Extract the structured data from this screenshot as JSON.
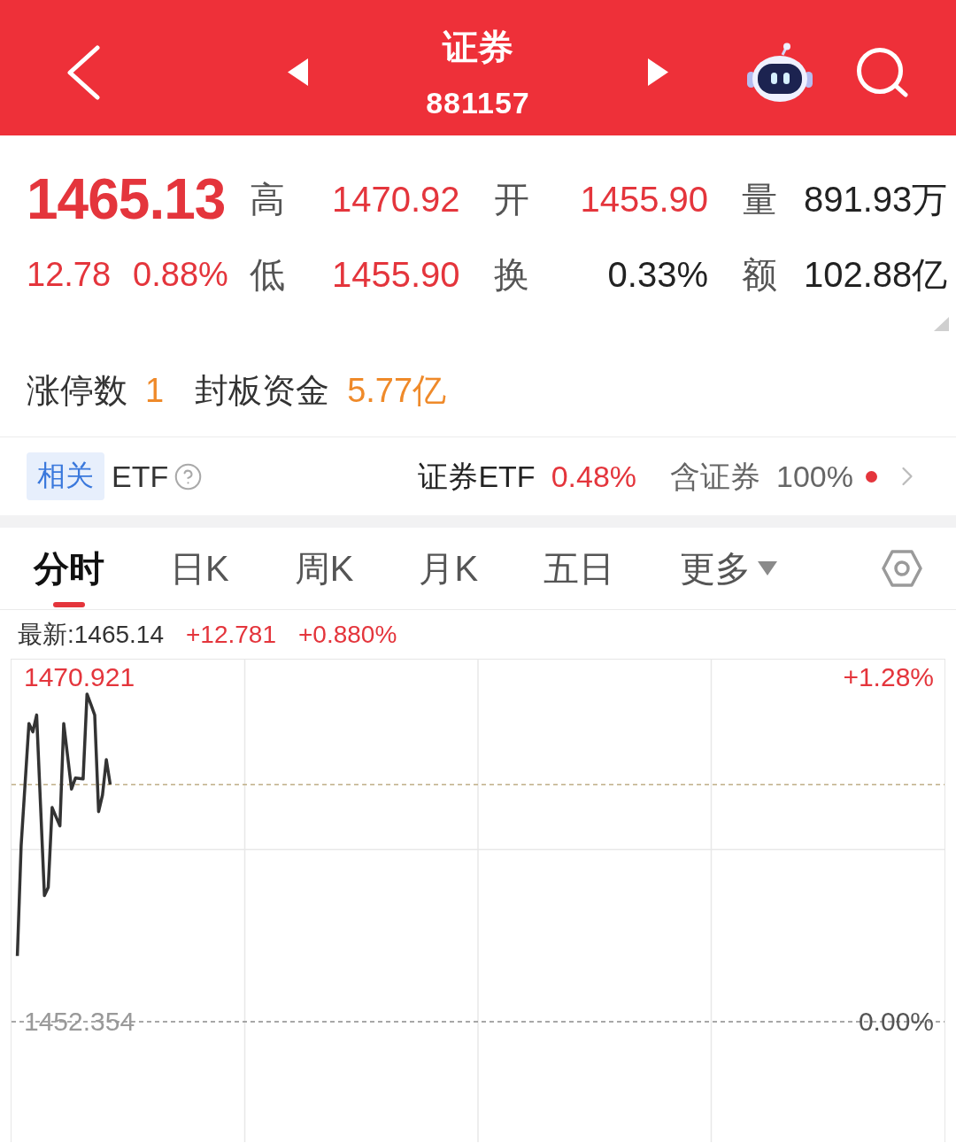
{
  "header": {
    "title": "证券",
    "code": "881157"
  },
  "quote": {
    "price": "1465.13",
    "change": "12.78",
    "change_pct": "0.88%",
    "stats": [
      {
        "label": "高",
        "value": "1470.92",
        "kind": "price"
      },
      {
        "label": "开",
        "value": "1455.90",
        "kind": "price"
      },
      {
        "label": "量",
        "value": "891.93万",
        "kind": "plain"
      },
      {
        "label": "低",
        "value": "1455.90",
        "kind": "price"
      },
      {
        "label": "换",
        "value": "0.33%",
        "kind": "plain"
      },
      {
        "label": "额",
        "value": "102.88亿",
        "kind": "plain"
      }
    ]
  },
  "limit_up": [
    {
      "label": "涨停数",
      "value": "1"
    },
    {
      "label": "封板资金",
      "value": "5.77亿"
    }
  ],
  "etf": {
    "tag": "相关",
    "label": "ETF",
    "fund_name": "证券ETF",
    "fund_change": "0.48%",
    "holding_label": "含证券",
    "holding_pct": "100%",
    "alert": true
  },
  "tabs": [
    {
      "label": "分时",
      "selected": true,
      "kind": "period"
    },
    {
      "label": "日K",
      "selected": false,
      "kind": "period"
    },
    {
      "label": "周K",
      "selected": false,
      "kind": "period"
    },
    {
      "label": "月K",
      "selected": false,
      "kind": "period"
    },
    {
      "label": "五日",
      "selected": false,
      "kind": "period"
    },
    {
      "label": "更多",
      "selected": false,
      "kind": "menu"
    }
  ],
  "intraday": {
    "latest": "最新:1465.14",
    "change": "+12.781",
    "change_pct": "+0.880%",
    "chart_data": {
      "type": "line",
      "categories": [
        null,
        null,
        null,
        null,
        null,
        null,
        null,
        null,
        null,
        null,
        null,
        null,
        null,
        null,
        null,
        null,
        null,
        null,
        null,
        null,
        null,
        null,
        null,
        null,
        null,
        null,
        null,
        null,
        null,
        null,
        null,
        null,
        null,
        null,
        null,
        null,
        null,
        null,
        null,
        null,
        null,
        null,
        null,
        null,
        null,
        null,
        null,
        null,
        null,
        null,
        null,
        null,
        null,
        null,
        null,
        null,
        null,
        null,
        null,
        null,
        null,
        null,
        null,
        null,
        null,
        null,
        null,
        null,
        null,
        null,
        null,
        null,
        null,
        null,
        null,
        null,
        null,
        null,
        null,
        null,
        null,
        null,
        null,
        null,
        null,
        null,
        null,
        null,
        null,
        null,
        null,
        null,
        null,
        null,
        null,
        null,
        null,
        null,
        null,
        null,
        null,
        null,
        null,
        null,
        null,
        null,
        null,
        null,
        null,
        null,
        null,
        null,
        null,
        null,
        null,
        null,
        null,
        null,
        null,
        null,
        null,
        null,
        null,
        null,
        null,
        null,
        null,
        null,
        null,
        null,
        null,
        null,
        null,
        null,
        null,
        null,
        null,
        null,
        null,
        null,
        null,
        null,
        null,
        null,
        null,
        null,
        null,
        null,
        null,
        null,
        null,
        null,
        null,
        null,
        null,
        null,
        null,
        null,
        null,
        null,
        null,
        null,
        null,
        null,
        null,
        null,
        null,
        null,
        null,
        null,
        null,
        null,
        null,
        null,
        null,
        null,
        null,
        null,
        null,
        null,
        null,
        null,
        null,
        null,
        null,
        null,
        null,
        null,
        null,
        null,
        null,
        null,
        null,
        null,
        null,
        null,
        null,
        null,
        null,
        null,
        null,
        null,
        null,
        null,
        null,
        null,
        null,
        null,
        null,
        null,
        null,
        null,
        null,
        null,
        null,
        null,
        null,
        null,
        null,
        null,
        null,
        null,
        null,
        null,
        null,
        null,
        null,
        null,
        null,
        null,
        null,
        null,
        null,
        null,
        null,
        null,
        null,
        null,
        null,
        null,
        null
      ],
      "series": [
        {
          "color": "#333333",
          "values": [
            null,
            1455.9,
            1461.86,
            1465.15,
            1468.43,
            1467.98,
            1468.89,
            1464.02,
            1459.15,
            1459.6,
            1463.9,
            1463.4,
            1462.91,
            1468.43,
            1466.67,
            1464.9,
            1465.49,
            1465.47,
            1465.44,
            1470.02,
            1469.46,
            1468.89,
            1463.68,
            1464.58,
            1466.48,
            1465.14,
            null,
            null,
            null,
            null,
            null,
            null,
            null,
            null,
            null,
            null,
            null,
            null,
            null,
            null,
            null,
            null,
            null,
            null,
            null,
            null,
            null,
            null,
            null,
            null,
            null,
            null,
            null,
            null,
            null,
            null,
            null,
            null,
            null,
            null,
            null,
            null,
            null,
            null,
            null,
            null,
            null,
            null,
            null,
            null,
            null,
            null,
            null,
            null,
            null,
            null,
            null,
            null,
            null,
            null,
            null,
            null,
            null,
            null,
            null,
            null,
            null,
            null,
            null,
            null,
            null,
            null,
            null,
            null,
            null,
            null,
            null,
            null,
            null,
            null,
            null,
            null,
            null,
            null,
            null,
            null,
            null,
            null,
            null,
            null,
            null,
            null,
            null,
            null,
            null,
            null,
            null,
            null,
            null,
            null,
            null,
            null,
            null,
            null,
            null,
            null,
            null,
            null,
            null,
            null,
            null,
            null,
            null,
            null,
            null,
            null,
            null,
            null,
            null,
            null,
            null,
            null,
            null,
            null,
            null,
            null,
            null,
            null,
            null,
            null,
            null,
            null,
            null,
            null,
            null,
            null,
            null,
            null,
            null,
            null,
            null,
            null,
            null,
            null,
            null,
            null,
            null,
            null,
            null,
            null,
            null,
            null,
            null,
            null,
            null,
            null,
            null,
            null,
            null,
            null,
            null,
            null,
            null,
            null,
            null,
            null,
            null,
            null,
            null,
            null,
            null,
            null,
            null,
            null,
            null,
            null,
            null,
            null,
            null,
            null,
            null,
            null,
            null,
            null,
            null,
            null,
            null,
            null,
            null,
            null,
            null,
            null,
            null,
            null,
            null,
            null,
            null,
            null,
            null,
            null,
            null,
            null,
            null,
            null,
            null,
            null,
            null,
            null,
            null,
            null,
            null,
            null,
            null,
            null,
            null,
            null,
            null,
            null,
            null,
            null,
            null
          ]
        }
      ],
      "ylim": [
        1445.863,
        1471.876
      ],
      "yticks": [
        {
          "value": 1470.921,
          "label": "1470.921"
        },
        {
          "value": 1452.354,
          "label": "1452.354"
        }
      ],
      "ref_lines": [
        {
          "axis": "y",
          "value": 1465.14,
          "color": "#bfae86"
        },
        {
          "axis": "y",
          "value": 1452.354,
          "color": "#8a8a8a"
        }
      ],
      "annotations": [
        {
          "text": "+1.28%"
        },
        {
          "text": "0.00%"
        }
      ]
    }
  }
}
